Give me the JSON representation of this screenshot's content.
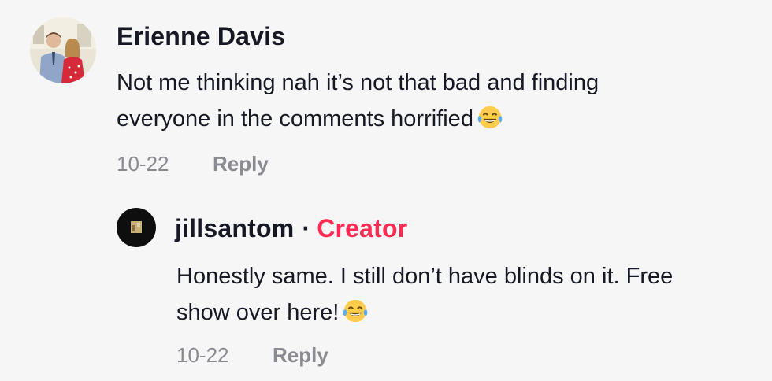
{
  "comments": [
    {
      "avatar": "user-photo-avatar",
      "username": "Erienne Davis",
      "text_line1": "Not me thinking nah it’s not that bad and finding",
      "text_line2": "everyone in the comments horrified",
      "emoji": "😂",
      "date": "10-22",
      "reply_label": "Reply"
    },
    {
      "avatar": "creator-avatar",
      "username": "jillsantom",
      "separator": "·",
      "badge": "Creator",
      "text_line1": "Honestly same. I still don’t have blinds on it. Free",
      "text_line2": "show over here!",
      "emoji": "😂",
      "date": "10-22",
      "reply_label": "Reply"
    }
  ],
  "colors": {
    "background": "#f6f6f6",
    "text": "#161823",
    "muted": "#8a8b91",
    "creator_badge": "#fe2c55"
  }
}
